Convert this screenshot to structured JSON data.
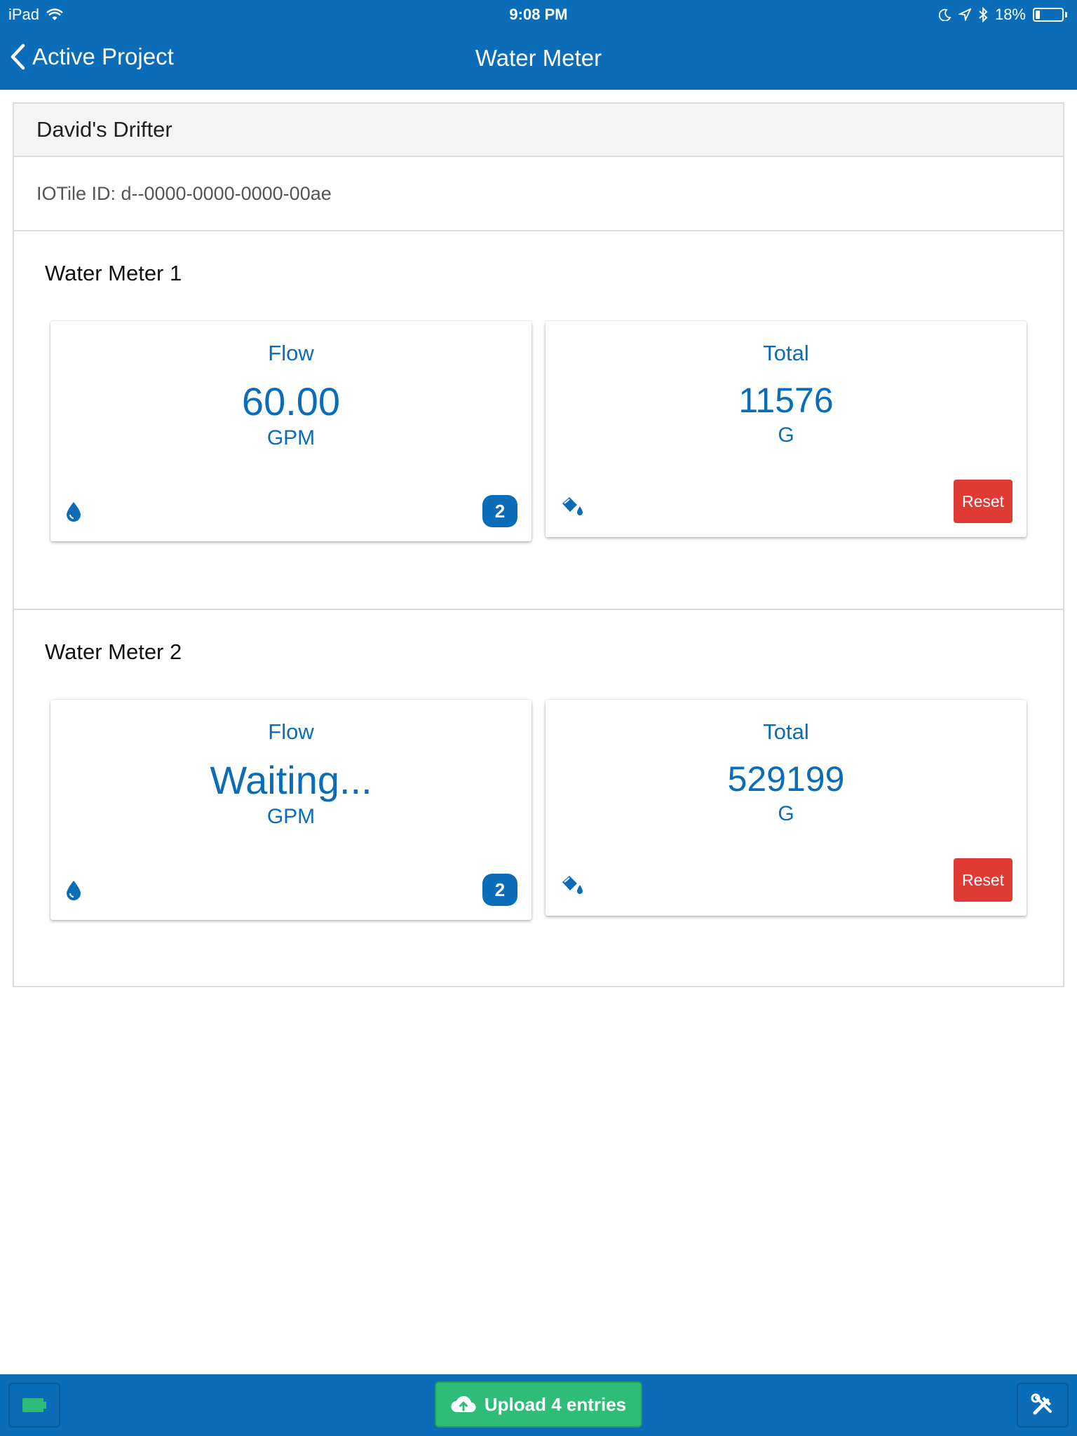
{
  "status_bar": {
    "device": "iPad",
    "time": "9:08 PM",
    "battery": "18%",
    "battery_level": 0.18
  },
  "nav": {
    "back_label": "Active Project",
    "title": "Water Meter"
  },
  "device": {
    "name": "David's Drifter",
    "iotile_id": "IOTile ID: d--0000-0000-0000-00ae"
  },
  "meters": [
    {
      "title": "Water Meter 1",
      "flow": {
        "label": "Flow",
        "value": "60.00",
        "unit": "GPM",
        "badge": "2"
      },
      "total": {
        "label": "Total",
        "value": "11576",
        "unit": "G",
        "reset_label": "Reset"
      }
    },
    {
      "title": "Water Meter 2",
      "flow": {
        "label": "Flow",
        "value": "Waiting...",
        "unit": "GPM",
        "badge": "2"
      },
      "total": {
        "label": "Total",
        "value": "529199",
        "unit": "G",
        "reset_label": "Reset"
      }
    }
  ],
  "footer": {
    "upload_label": "Upload 4 entries",
    "icons": [
      "battery-icon",
      "cloud-upload-icon",
      "tools-icon"
    ]
  },
  "colors": {
    "primary": "#0b6db7",
    "reset": "#e03a35",
    "upload": "#2ebc78"
  }
}
